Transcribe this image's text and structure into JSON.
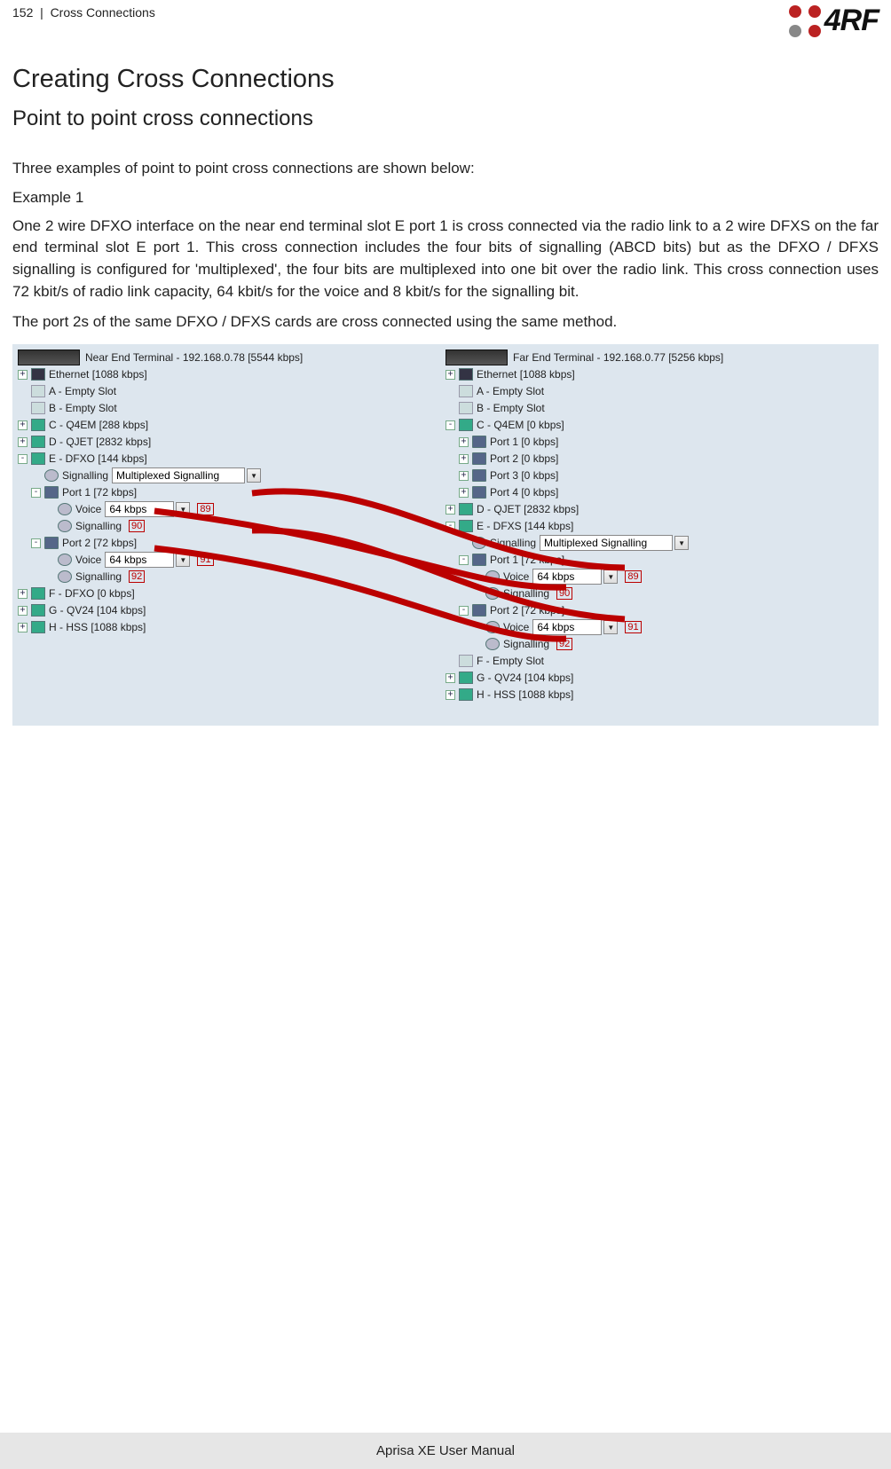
{
  "header": {
    "page_no": "152",
    "section": "Cross Connections",
    "brand": "4RF"
  },
  "headings": {
    "h1": "Creating Cross Connections",
    "h2": "Point to point cross connections"
  },
  "body": {
    "intro": "Three examples of point to point cross connections are shown below:",
    "example_label": "Example 1",
    "p1": "One 2 wire DFXO interface on the near end terminal slot E port 1 is cross connected via the radio link to a 2 wire DFXS on the far end terminal slot E port 1. This cross connection includes the four bits of signalling (ABCD bits) but as the DFXO / DFXS signalling is configured for 'multiplexed', the four bits are multiplexed into one bit over the radio link. This cross connection uses 72 kbit/s of radio link capacity, 64 kbit/s for the voice and 8 kbit/s for the signalling bit.",
    "p2": "The port 2s of the same DFXO / DFXS cards are cross connected using the same method."
  },
  "shot": {
    "near": {
      "title": "Near End Terminal - 192.168.0.78 [5544 kbps]",
      "eth": "Ethernet [1088 kbps]",
      "a": "A - Empty Slot",
      "b": "B - Empty Slot",
      "c": "C - Q4EM [288 kbps]",
      "d": "D - QJET [2832 kbps]",
      "e": "E - DFXO [144 kbps]",
      "sig_label": "Signalling",
      "sig_value": "Multiplexed Signalling",
      "port1": "Port 1 [72 kbps]",
      "port2": "Port 2 [72 kbps]",
      "voice_label": "Voice",
      "voice_value": "64 kbps",
      "sig_sub": "Signalling",
      "f": "F - DFXO [0 kbps]",
      "g": "G - QV24 [104 kbps]",
      "h": "H - HSS [1088 kbps]",
      "badge89": "89",
      "badge90": "90",
      "badge91": "91",
      "badge92": "92"
    },
    "far": {
      "title": "Far End Terminal - 192.168.0.77 [5256 kbps]",
      "eth": "Ethernet [1088 kbps]",
      "a": "A - Empty Slot",
      "b": "B - Empty Slot",
      "c": "C - Q4EM [0 kbps]",
      "c_p1": "Port 1 [0 kbps]",
      "c_p2": "Port 2 [0 kbps]",
      "c_p3": "Port 3 [0 kbps]",
      "c_p4": "Port 4 [0 kbps]",
      "d": "D - QJET [2832 kbps]",
      "e": "E - DFXS [144 kbps]",
      "sig_label": "Signalling",
      "sig_value": "Multiplexed Signalling",
      "port1": "Port 1 [72 kbps]",
      "port2": "Port 2 [72 kbps]",
      "voice_label": "Voice",
      "voice_value": "64 kbps",
      "sig_sub": "Signalling",
      "f": "F - Empty Slot",
      "g": "G - QV24 [104 kbps]",
      "h": "H - HSS [1088 kbps]",
      "badge89": "89",
      "badge90": "90",
      "badge91": "91",
      "badge92": "92"
    }
  },
  "footer": {
    "text": "Aprisa XE User Manual"
  }
}
